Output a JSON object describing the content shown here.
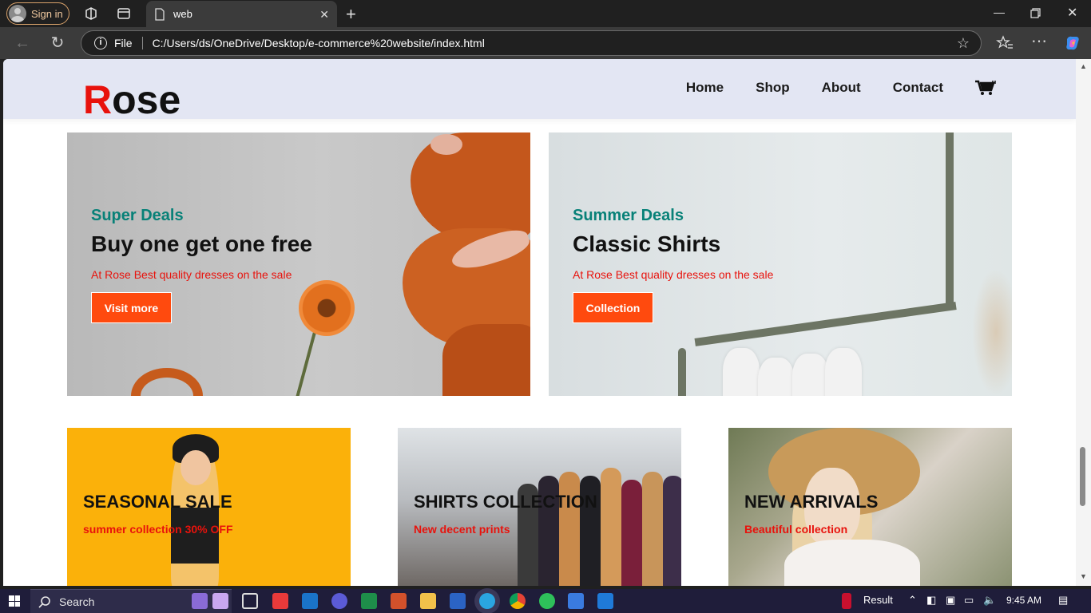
{
  "browser": {
    "signin_label": "Sign in",
    "tab_title": "web",
    "address_scheme": "File",
    "address_url": "C:/Users/ds/OneDrive/Desktop/e-commerce%20website/index.html"
  },
  "site": {
    "logo_first": "R",
    "logo_rest": "ose",
    "nav": [
      "Home",
      "Shop",
      "About",
      "Contact"
    ],
    "banners": [
      {
        "label": "Super Deals",
        "title": "Buy one get one free",
        "subtitle": "At Rose Best quality dresses on the sale",
        "button": "Visit more"
      },
      {
        "label": "Summer Deals",
        "title": "Classic Shirts",
        "subtitle": "At Rose Best quality dresses on the sale",
        "button": "Collection"
      }
    ],
    "small_banners": [
      {
        "title": "SEASONAL SALE",
        "subtitle": "summer collection 30% OFF"
      },
      {
        "title": "SHIRTS COLLECTION",
        "subtitle": "New decent prints"
      },
      {
        "title": "NEW ARRIVALS",
        "subtitle": "Beautiful collection"
      }
    ],
    "colors": {
      "accent_red": "#e8120c",
      "teal": "#088178",
      "button_orange": "#ff4a0e",
      "header_bg": "#e3e6f3"
    }
  },
  "taskbar": {
    "search_label": "Search",
    "result_label": "Result",
    "time": "9:45 AM"
  },
  "icons": [
    "user-avatar-icon",
    "workspaces-icon",
    "tab-actions-icon",
    "page-icon",
    "close-icon",
    "plus-icon",
    "minimize-icon",
    "maximize-icon",
    "back-icon",
    "refresh-icon",
    "info-icon",
    "star-icon",
    "favorites-icon",
    "more-icon",
    "copilot-icon",
    "cart-icon",
    "windows-icon",
    "search-icon"
  ]
}
